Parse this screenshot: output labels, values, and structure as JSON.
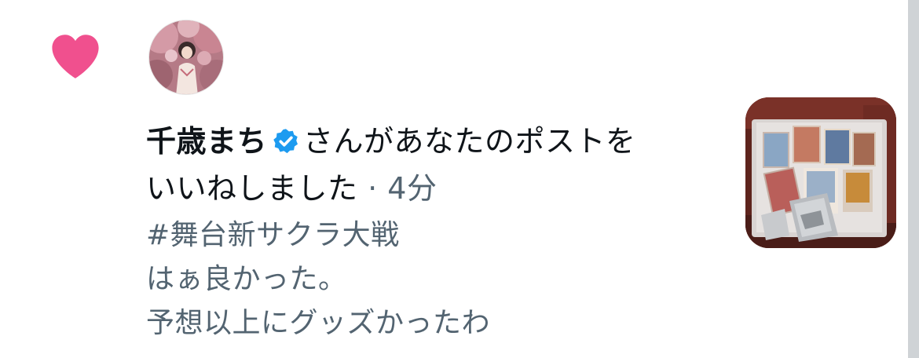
{
  "notification": {
    "type_icon": "heart-icon",
    "accent_color": "#f0508e",
    "verified_color": "#1d9bf0",
    "user": {
      "name": "千歳まち",
      "avatar": "avatar-photo",
      "verified": true
    },
    "action_text_line1": "さんがあなたのポストを",
    "action_text_line2": "いいねしました",
    "separator": "·",
    "time": "4分",
    "tweet_lines": [
      "#舞台新サクラ大戦",
      "はぁ良かった。",
      "予想以上にグッズかったわ"
    ],
    "media_thumbnail": "merchandise-photo"
  }
}
